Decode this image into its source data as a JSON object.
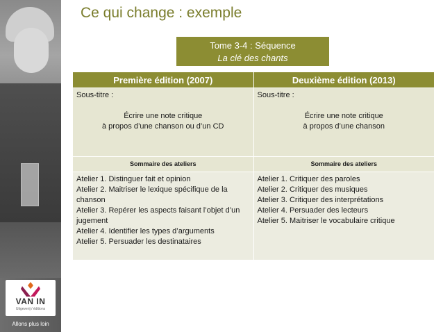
{
  "page": {
    "title": "Ce qui change : exemple"
  },
  "tome": {
    "line1": "Tome 3-4 : Séquence",
    "line2": "La clé des chants"
  },
  "table": {
    "headers": [
      "Première édition (2007)",
      "Deuxième édition (2013)"
    ],
    "subtitle_label": "Sous-titre :",
    "subtitles": [
      [
        "Écrire une note critique",
        "à propos d’une chanson ou d’un CD"
      ],
      [
        "Écrire une note critique",
        "à propos d’une chanson"
      ]
    ],
    "summary_label": "Sommaire des ateliers",
    "ateliers": [
      [
        "Atelier 1. Distinguer fait et opinion",
        "Atelier 2. Maitriser le lexique spécifique de la chanson",
        "Atelier 3. Repérer les aspects faisant l’objet d’un jugement",
        "Atelier 4. Identifier les types d’arguments",
        "Atelier 5. Persuader les destinataires"
      ],
      [
        "Atelier 1. Critiquer des paroles",
        "Atelier 2. Critiquer des musiques",
        "Atelier 3. Critiquer des interprétations",
        "Atelier 4. Persuader des lecteurs",
        "Atelier 5. Maitriser le vocabulaire critique"
      ]
    ]
  },
  "sidebar": {
    "logo_text": "VAN IN",
    "logo_subtext": "Uitgeverij / éditions",
    "tagline": "Allons plus loin"
  },
  "colors": {
    "accent": "#8c8d33",
    "title": "#7a7d2c",
    "row_light": "#e6e6d2",
    "row_lighter": "#ecece0"
  },
  "icons": {
    "logo": "van-in-logo-icon"
  }
}
